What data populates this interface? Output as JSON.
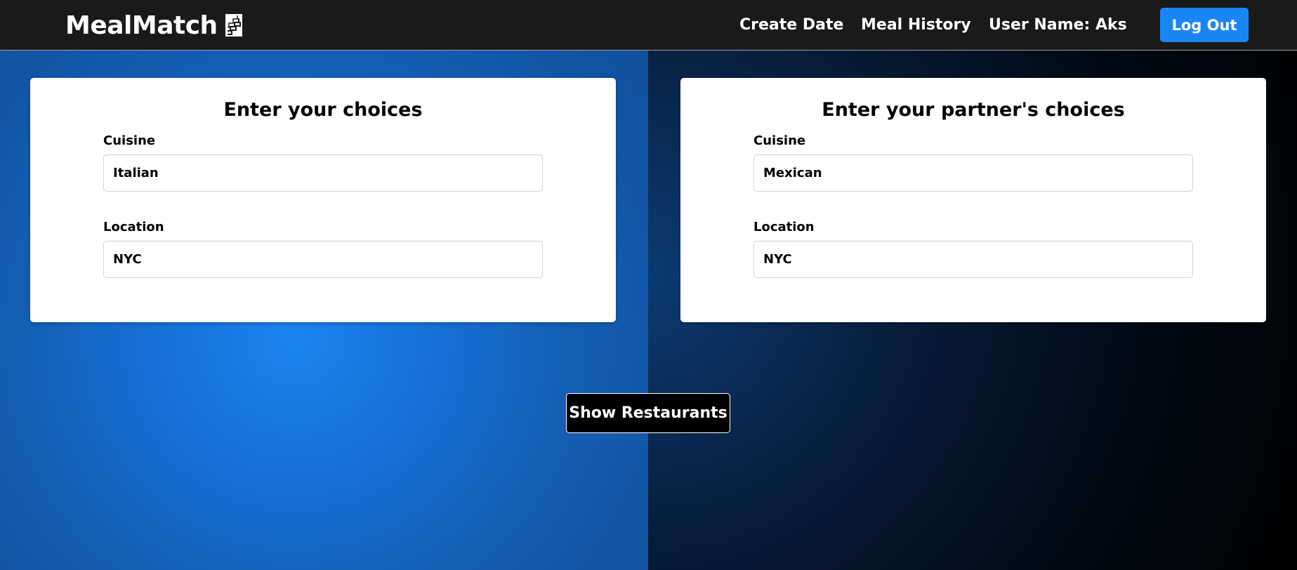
{
  "navbar": {
    "brand": "MealMatch",
    "brand_icon": "stairs-logo-icon",
    "links": {
      "create_date": "Create Date",
      "meal_history": "Meal History",
      "user_name": "User Name: Aks"
    },
    "logout_label": "Log Out"
  },
  "your_choices": {
    "title": "Enter your choices",
    "cuisine_label": "Cuisine",
    "cuisine_value": "Italian",
    "location_label": "Location",
    "location_value": "NYC"
  },
  "partner_choices": {
    "title": "Enter your partner's choices",
    "cuisine_label": "Cuisine",
    "cuisine_value": "Mexican",
    "location_label": "Location",
    "location_value": "NYC"
  },
  "actions": {
    "show_restaurants_label": "Show Restaurants"
  },
  "colors": {
    "navbar_bg": "#1b1a1a",
    "accent_blue": "#1a86f5",
    "left_bg": "#1672d8",
    "right_bg": "#000000"
  }
}
